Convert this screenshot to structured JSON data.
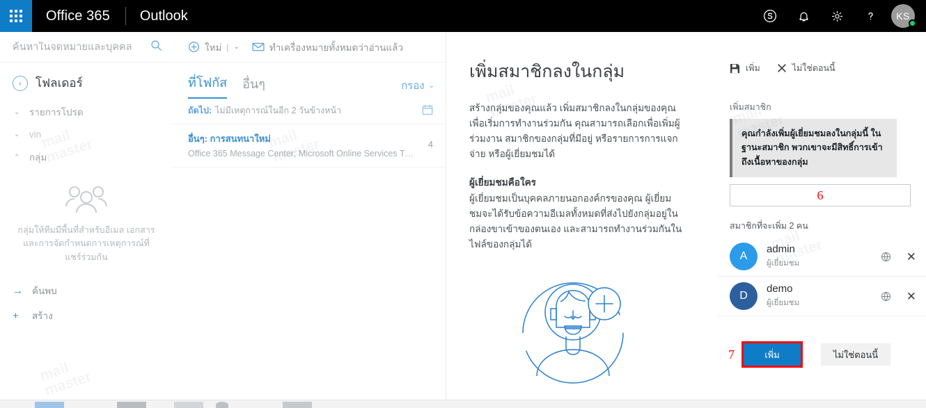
{
  "topbar": {
    "waffle_label": "App launcher",
    "brand": "Office 365",
    "app_name": "Outlook",
    "icons": [
      {
        "name": "skype-icon",
        "glyph": "S"
      },
      {
        "name": "notifications-bell-icon",
        "glyph": "bell"
      },
      {
        "name": "settings-gear-icon",
        "glyph": "gear"
      },
      {
        "name": "help-question-icon",
        "glyph": "?"
      }
    ],
    "avatar_initials": "KS",
    "presence_color": "#10d070",
    "accent_color": "#0f7cc7"
  },
  "sidebar": {
    "search_placeholder": "ค้นหาในจดหมายและบุคคล",
    "search_value": "",
    "back_icon": "back-arrow-icon",
    "folders_title": "โฟลเดอร์",
    "items": [
      {
        "label": "รายการโปรด",
        "chevron": "⌄",
        "dim": false
      },
      {
        "label": "vin",
        "chevron": "⌄",
        "dim": true
      },
      {
        "label": "กลุ่ม",
        "chevron": "⌃",
        "dim": false
      }
    ],
    "groups_empty_text": "กลุ่มให้ทีมมีพื้นที่สำหรับอีเมล เอกสาร และการจัดกำหนดการเหตุการณ์ที่แชร์ร่วมกัน",
    "bottom_items": [
      {
        "label": "ค้นพบ",
        "icon": "arrow-right-icon"
      },
      {
        "label": "สร้าง",
        "icon": "plus-icon"
      }
    ]
  },
  "messagelist": {
    "toolbar": {
      "new_label": "ใหม่",
      "new_icon": "plus-circle-icon",
      "separator": "|",
      "caret": "⌄",
      "mark_all_read_label": "ทำเครื่องหมายทั้งหมดว่าอ่านแล้ว",
      "mark_all_read_icon": "envelope-icon"
    },
    "tabs": [
      {
        "label": "ที่โฟกัส",
        "active": true
      },
      {
        "label": "อื่นๆ",
        "active": false
      }
    ],
    "filter_label": "กรอง",
    "filter_caret": "⌄",
    "next_key": "ถัดไป:",
    "next_value": "ไม่มีเหตุการณ์ในอีก 2 วันข้างหน้า",
    "calendar_icon": "calendar-icon",
    "messages": [
      {
        "subject": "อื่นๆ: การสนทนาใหม่",
        "from": "Office 365 Message Center; Microsoft Online Services T…",
        "count": "4"
      }
    ]
  },
  "main": {
    "title": "เพิ่มสมาชิกลงในกลุ่ม",
    "paragraph1": "สร้างกลุ่มของคุณแล้ว เพิ่มสมาชิกลงในกลุ่มของคุณเพื่อเริ่มการทำงานร่วมกัน คุณสามารถเลือกเพื่อเพิ่มผู้ร่วมงาน สมาชิกของกลุ่มที่มีอยู่ หรือรายการการแจกจ่าย หรือผู้เยี่ยมชมได้",
    "heading2": "ผู้เยี่ยมชมคือใคร",
    "paragraph2": "ผู้เยี่ยมชมเป็นบุคคลภายนอกองค์กรของคุณ ผู้เยี่ยมชมจะได้รับข้อความอีเมลทั้งหมดที่ส่งไปยังกลุ่มอยู่ในกล่องขาเข้าของตนเอง และสามารถทำงานร่วมกันในไฟล์ของกลุ่มได้",
    "illustration_icon": "add-person-illustration"
  },
  "rightpane": {
    "toolbar": [
      {
        "label": "เพิ่ม",
        "icon": "save-disk-icon"
      },
      {
        "label": "ไม่ใช่ตอนนี้",
        "icon": "close-x-icon"
      }
    ],
    "add_members_label": "เพิ่มสมาชิก",
    "tooltip_text": "คุณกำลังเพิ่มผู้เยี่ยมชมลงในกลุ่มนี้ ในฐานะสมาชิก พวกเขาจะมีสิทธิ์การเข้าถึงเนื้อหาของกลุ่ม",
    "input_value": "",
    "input_annotation": "6",
    "members_label": "สมาชิกที่จะเพิ่ม 2 คน",
    "members": [
      {
        "initial": "A",
        "name": "admin",
        "role": "ผู้เยี่ยมชม",
        "avatar_color": "#2b9bea",
        "globe_icon": "globe-icon",
        "remove_icon": "remove-x-icon"
      },
      {
        "initial": "D",
        "name": "demo",
        "role": "ผู้เยี่ยมชม",
        "avatar_color": "#2b5f9e",
        "globe_icon": "globe-icon",
        "remove_icon": "remove-x-icon"
      }
    ],
    "primary_button": "เพิ่ม",
    "primary_annotation": "7",
    "secondary_button": "ไม่ใช่ตอนนี้",
    "highlight_color": "#ff0000",
    "primary_color": "#0f7cc7"
  },
  "watermarks": [
    "mail\nmaster",
    "mail\nmaster",
    "mail\nmaster",
    "mail\nmaster",
    "mail\nmaster"
  ]
}
